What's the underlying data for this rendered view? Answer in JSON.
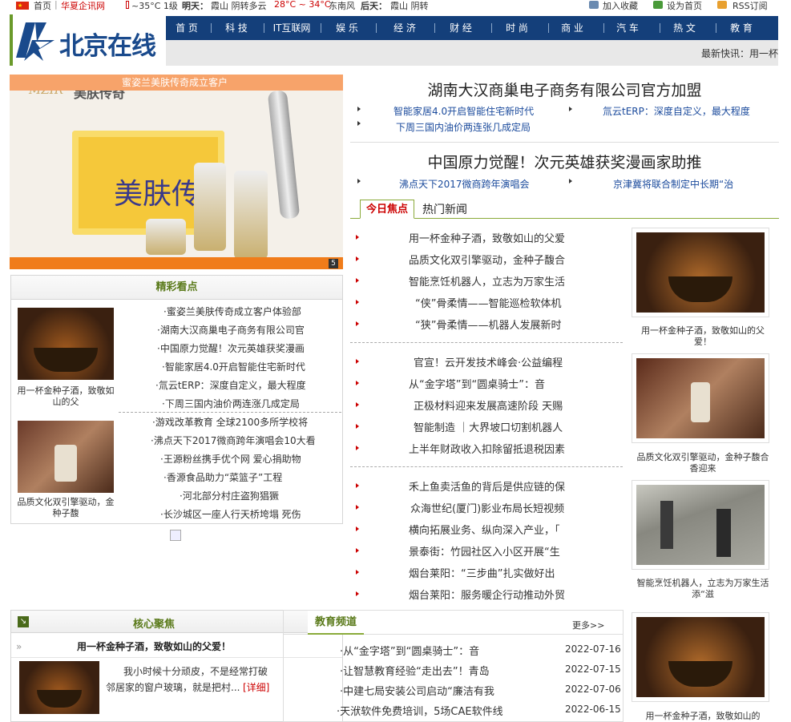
{
  "topbar": {
    "home": "首页",
    "sep": "|",
    "huaxia": "华夏企讯网",
    "weather_today": "~35°C 1级",
    "tomorrow_label": "明天：",
    "tomorrow": "霞山 阴转多云",
    "tomorrow_temp": "28°C ~ 34°C",
    "tomorrow_wind": "东南风",
    "after_label": "后天：",
    "after": "霞山 阴转",
    "fav": "加入收藏",
    "sethome": "设为首页",
    "rss": "RSS订阅"
  },
  "logo": {
    "text": "北京在线"
  },
  "nav": [
    "首 页",
    "科 技",
    "IT互联网",
    "娱 乐",
    "经 济",
    "财 经",
    "时 尚",
    "商 业",
    "汽 车",
    "热 文",
    "教 育"
  ],
  "ticker": "最新快讯：用一杯",
  "slider": {
    "caption": "蜜姿兰美肤传奇成立客户",
    "brand": "美肤传奇",
    "product": "美肤传",
    "page": "5"
  },
  "jingcai": {
    "title": "精彩看点",
    "img1_caption": "用一杯金种子酒，致敬如山的父",
    "img2_caption": "品质文化双引擎驱动，金种子馥",
    "list1": [
      "·蜜姿兰美肤传奇成立客户体验部",
      "·湖南大汉商巢电子商务有限公司官",
      "·中国原力觉醒！次元英雄获奖漫画",
      "·智能家居4.0开启智能住宅新时代",
      "·氚云tERP：深度自定义，最大程度",
      "·下周三国内油价两连涨几成定局"
    ],
    "list2": [
      "·游戏改革教育 全球2100多所学校将",
      "·沸点天下2017微商跨年演唱会10大看",
      "·王源粉丝携手优个网 爱心捐助物",
      "·香源食品助力“菜篮子”工程",
      "·河北部分村庄盗狗猖獗",
      "·长沙城区一座人行天桥垮塌 死伤"
    ]
  },
  "headline1": {
    "title": "湖南大汉商巢电子商务有限公司官方加盟",
    "sub": [
      "智能家居4.0开启智能住宅新时代",
      "氚云tERP：深度自定义，最大程度",
      "下周三国内油价两连张几成定局"
    ]
  },
  "headline2": {
    "title": "中国原力觉醒！次元英雄获奖漫画家助推",
    "sub": [
      "沸点天下2017微商跨年演唱会",
      "京津冀将联合制定中长期“治"
    ]
  },
  "tabs": {
    "active": "今日焦点",
    "other": "热门新闻"
  },
  "focus": {
    "group1": [
      "用一杯金种子酒，致敬如山的父爱",
      "品质文化双引擎驱动，金种子馥合",
      "智能烹饪机器人，立志为万家生活",
      "“侠”骨柔情——智能巡检软体机",
      "“狭”骨柔情——机器人发展新时"
    ],
    "group2": [
      "官宣！云开发技术峰会·公益编程",
      "从“金字塔”到“圆桌骑士”：音",
      "正极材料迎来发展高速阶段 天赐",
      "智能制造 ｜大界坡口切割机器人",
      "上半年财政收入扣除留抵退税因素"
    ],
    "group3": [
      "禾上鱼卖活鱼的背后是供应链的保",
      "众海世纪(厦门)影业布局长短视频",
      "横向拓展业务、纵向深入产业，「",
      "景泰街：竹园社区入小区开展“生",
      "烟台莱阳：“三步曲”扎实做好出",
      "烟台莱阳：服务暖企行动推动外贸"
    ]
  },
  "right_images": [
    {
      "caption": "用一杯金种子酒，致敬如山的父爱！"
    },
    {
      "caption": "品质文化双引擎驱动，金种子馥合香迎来"
    },
    {
      "caption": "智能烹饪机器人，立志为万家生活添“滋"
    },
    {
      "caption": "用一杯金种子酒，致敬如山的"
    }
  ],
  "hexin": {
    "title": "核心聚焦",
    "headline": "用一杯金种子酒，致敬如山的父爱！",
    "text1": "我小时候十分顽皮，不是经常打破",
    "text2": "邻居家的窗户玻璃，就是把村...",
    "more": "[详细]"
  },
  "edu": {
    "title": "教育频道",
    "more": "更多>>",
    "items": [
      {
        "t": "·从“金字塔”到“圆桌骑士”：音",
        "d": "2022-07-16"
      },
      {
        "t": "·让智慧教育经验“走出去”！青岛",
        "d": "2022-07-15"
      },
      {
        "t": "·中建七局安装公司启动“廉洁有我",
        "d": "2022-07-06"
      },
      {
        "t": "·天洑软件免费培训，5场CAE软件线",
        "d": "2022-06-15"
      }
    ]
  },
  "colors": {
    "nav": "#143f7a",
    "accent": "#c00000",
    "green": "#5a7a1a",
    "orange": "#f07c1a"
  }
}
